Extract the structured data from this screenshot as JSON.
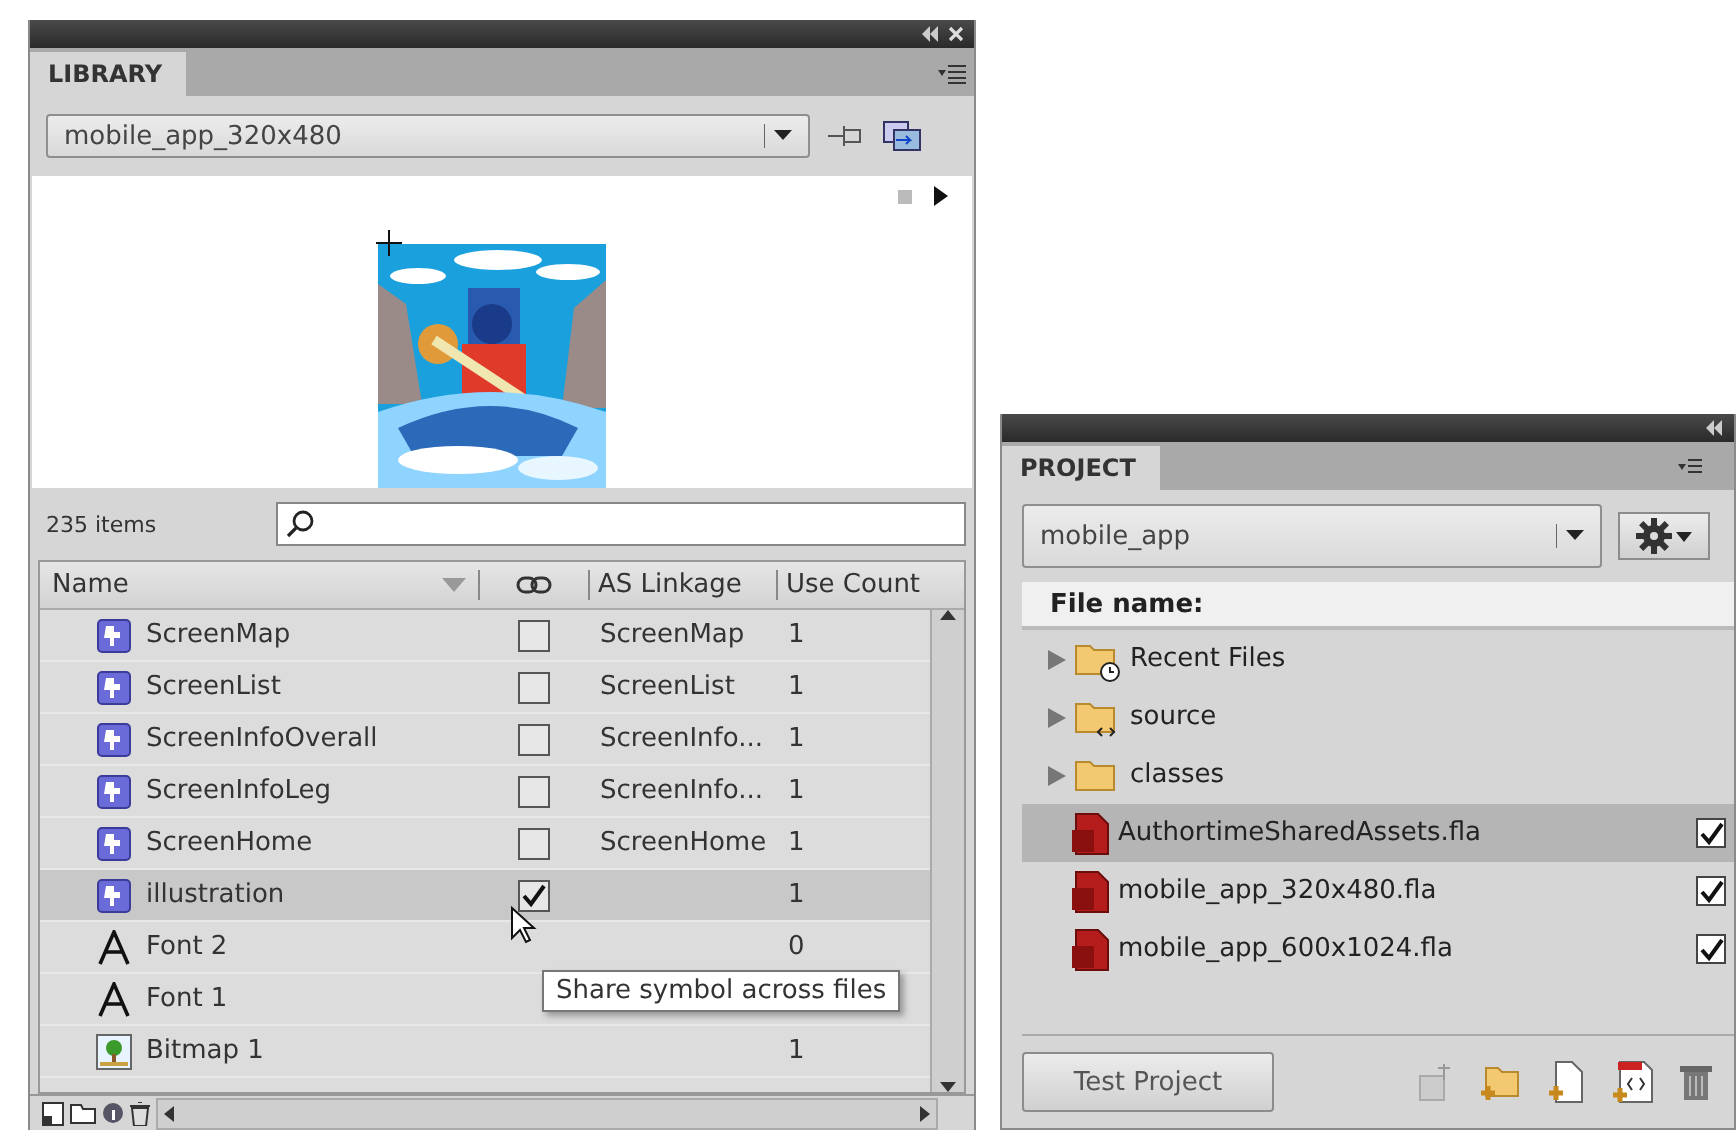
{
  "library": {
    "tab": "LIBRARY",
    "document": "mobile_app_320x480",
    "item_count": "235 items",
    "columns": [
      "Name",
      "AS Linkage",
      "Use Count"
    ],
    "items": [
      {
        "kind": "symbol",
        "name": "ScreenMap",
        "shared": false,
        "linkage": "ScreenMap",
        "use_count": "1",
        "selected": false
      },
      {
        "kind": "symbol",
        "name": "ScreenList",
        "shared": false,
        "linkage": "ScreenList",
        "use_count": "1",
        "selected": false
      },
      {
        "kind": "symbol",
        "name": "ScreenInfoOverall",
        "shared": false,
        "linkage": "ScreenInfo...",
        "use_count": "1",
        "selected": false
      },
      {
        "kind": "symbol",
        "name": "ScreenInfoLeg",
        "shared": false,
        "linkage": "ScreenInfo...",
        "use_count": "1",
        "selected": false
      },
      {
        "kind": "symbol",
        "name": "ScreenHome",
        "shared": false,
        "linkage": "ScreenHome",
        "use_count": "1",
        "selected": false
      },
      {
        "kind": "symbol",
        "name": "illustration",
        "shared": true,
        "use_count": "1",
        "selected": true
      },
      {
        "kind": "font",
        "name": "Font 2",
        "use_count": "0",
        "selected": false
      },
      {
        "kind": "font",
        "name": "Font 1",
        "selected": false
      },
      {
        "kind": "bitmap",
        "name": "Bitmap 1",
        "use_count": "1",
        "selected": false
      }
    ],
    "tooltip": "Share symbol across files"
  },
  "project": {
    "tab": "PROJECT",
    "project_name": "mobile_app",
    "header": "File name:",
    "entries": [
      {
        "kind": "recent_folder",
        "name": "Recent Files",
        "selected": false
      },
      {
        "kind": "source_folder",
        "name": "source",
        "selected": false
      },
      {
        "kind": "folder",
        "name": "classes",
        "selected": false
      },
      {
        "kind": "file",
        "name": "AuthortimeSharedAssets.fla",
        "included": true,
        "selected": true
      },
      {
        "kind": "file",
        "name": "mobile_app_320x480.fla",
        "included": true,
        "selected": false
      },
      {
        "kind": "file",
        "name": "mobile_app_600x1024.fla",
        "included": true,
        "selected": false
      }
    ],
    "test_button": "Test Project"
  }
}
